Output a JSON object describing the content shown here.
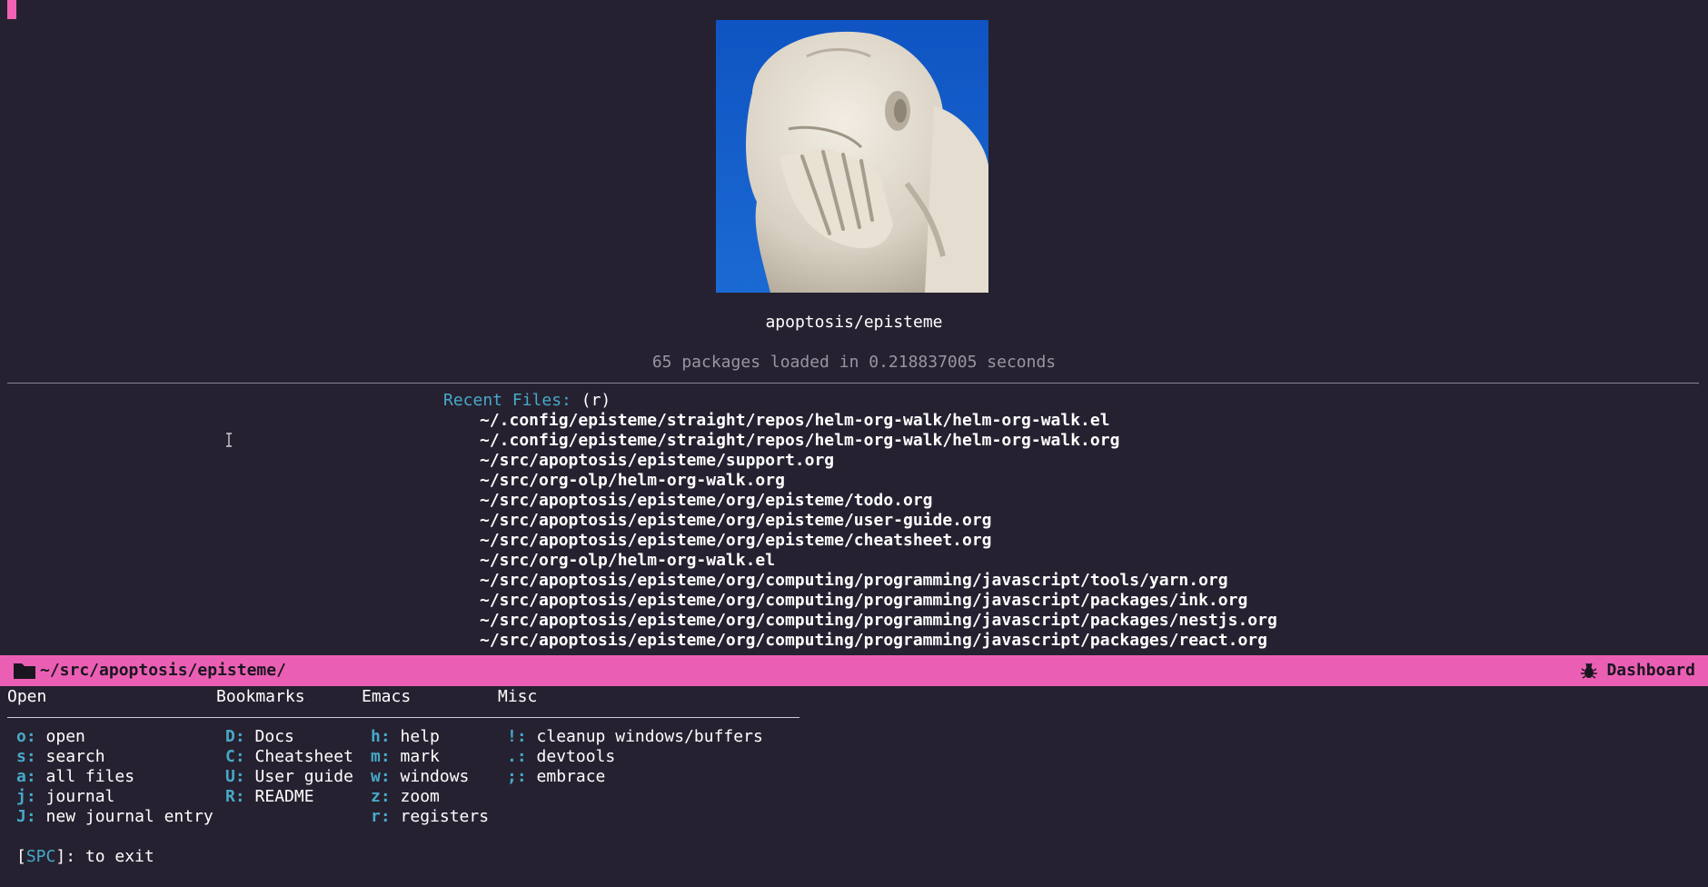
{
  "dashboard": {
    "project_name": "apoptosis/episteme",
    "load_info": "65 packages loaded in 0.218837005 seconds"
  },
  "recent": {
    "title": "Recent Files:",
    "key": "(r)",
    "items": [
      "~/.config/episteme/straight/repos/helm-org-walk/helm-org-walk.el",
      "~/.config/episteme/straight/repos/helm-org-walk/helm-org-walk.org",
      "~/src/apoptosis/episteme/support.org",
      "~/src/org-olp/helm-org-walk.org",
      "~/src/apoptosis/episteme/org/episteme/todo.org",
      "~/src/apoptosis/episteme/org/episteme/user-guide.org",
      "~/src/apoptosis/episteme/org/episteme/cheatsheet.org",
      "~/src/org-olp/helm-org-walk.el",
      "~/src/apoptosis/episteme/org/computing/programming/javascript/tools/yarn.org",
      "~/src/apoptosis/episteme/org/computing/programming/javascript/packages/ink.org",
      "~/src/apoptosis/episteme/org/computing/programming/javascript/packages/nestjs.org",
      "~/src/apoptosis/episteme/org/computing/programming/javascript/packages/react.org"
    ]
  },
  "modeline": {
    "path": "~/src/apoptosis/episteme/",
    "mode": "Dashboard",
    "colors": {
      "background": "#ea5fb3",
      "text": "#1a1620"
    }
  },
  "which_key": {
    "headers": [
      "Open",
      "Bookmarks",
      "Emacs",
      "Misc"
    ],
    "open": [
      {
        "key": "o",
        "label": "open"
      },
      {
        "key": "s",
        "label": "search"
      },
      {
        "key": "a",
        "label": "all files"
      },
      {
        "key": "j",
        "label": "journal"
      },
      {
        "key": "J",
        "label": "new journal entry"
      }
    ],
    "bookmarks": [
      {
        "key": "D",
        "label": "Docs"
      },
      {
        "key": "C",
        "label": "Cheatsheet"
      },
      {
        "key": "U",
        "label": "User guide"
      },
      {
        "key": "R",
        "label": "README"
      }
    ],
    "emacs": [
      {
        "key": "h",
        "label": "help"
      },
      {
        "key": "m",
        "label": "mark"
      },
      {
        "key": "w",
        "label": "windows"
      },
      {
        "key": "z",
        "label": "zoom"
      },
      {
        "key": "r",
        "label": "registers"
      }
    ],
    "misc": [
      {
        "key": "!",
        "label": "cleanup windows/buffers"
      },
      {
        "key": ".",
        "label": "devtools"
      },
      {
        "key": ";",
        "label": "embrace"
      }
    ],
    "exit_key": "SPC",
    "exit_label": "]: to exit",
    "key_sep": ": "
  },
  "icons": {
    "folder": "folder-icon",
    "bug": "bug-icon",
    "banner": "facepalm-statue-image"
  },
  "theme": {
    "background": "#262130",
    "accent": "#ea5fb3",
    "key_color": "#46a9c9"
  }
}
